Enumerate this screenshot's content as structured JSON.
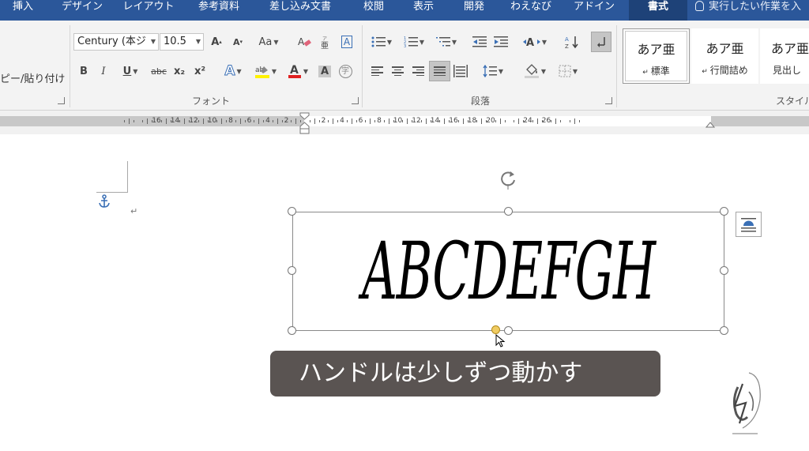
{
  "tabs": [
    {
      "label": "挿入",
      "active": false
    },
    {
      "label": "デザイン",
      "active": false
    },
    {
      "label": "レイアウト",
      "active": false
    },
    {
      "label": "参考資料",
      "active": false
    },
    {
      "label": "差し込み文書",
      "active": false
    },
    {
      "label": "校閲",
      "active": false
    },
    {
      "label": "表示",
      "active": false
    },
    {
      "label": "開発",
      "active": false
    },
    {
      "label": "わえなび",
      "active": false
    },
    {
      "label": "アドイン",
      "active": false
    },
    {
      "label": "書式",
      "active": true
    }
  ],
  "tell_me": "実行したい作業を入",
  "clipboard": {
    "paste_format": "ピー/貼り付け"
  },
  "font": {
    "group_label": "フォント",
    "family_value": "Century (本ジ",
    "size_value": "10.5",
    "change_case": "Aa",
    "buttons": {
      "bold": "B",
      "italic": "I",
      "underline": "U",
      "strike": "abc",
      "subscript": "x₂",
      "superscript": "x²"
    }
  },
  "paragraph": {
    "group_label": "段落"
  },
  "styles": {
    "group_label": "スタイル",
    "items": [
      {
        "sample": "あア亜",
        "name": "標準",
        "selected": true
      },
      {
        "sample": "あア亜",
        "name": "行間詰め",
        "selected": false
      },
      {
        "sample": "あア亜",
        "name": "見出し",
        "selected": false
      }
    ]
  },
  "ruler": {
    "left_numbers": [
      "16",
      "14",
      "12",
      "10",
      "8",
      "6",
      "4",
      "2"
    ],
    "right_numbers": [
      "2",
      "4",
      "6",
      "8",
      "10",
      "12",
      "14",
      "16",
      "18",
      "20",
      "24",
      "26"
    ]
  },
  "document": {
    "wordart_text": "ABCDEFGH",
    "para_mark": "↵"
  },
  "caption": "ハンドルは少しずつ動かす",
  "colors": {
    "tab_bar": "#2b579a",
    "active_tab": "#1e4278",
    "adjust_handle": "#f0cc62",
    "caption_bg": "#5a5452"
  },
  "icons": [
    "lightbulb-icon",
    "anchor-icon",
    "rotate-handle-icon",
    "layout-options-icon",
    "mouse-cursor-icon"
  ]
}
